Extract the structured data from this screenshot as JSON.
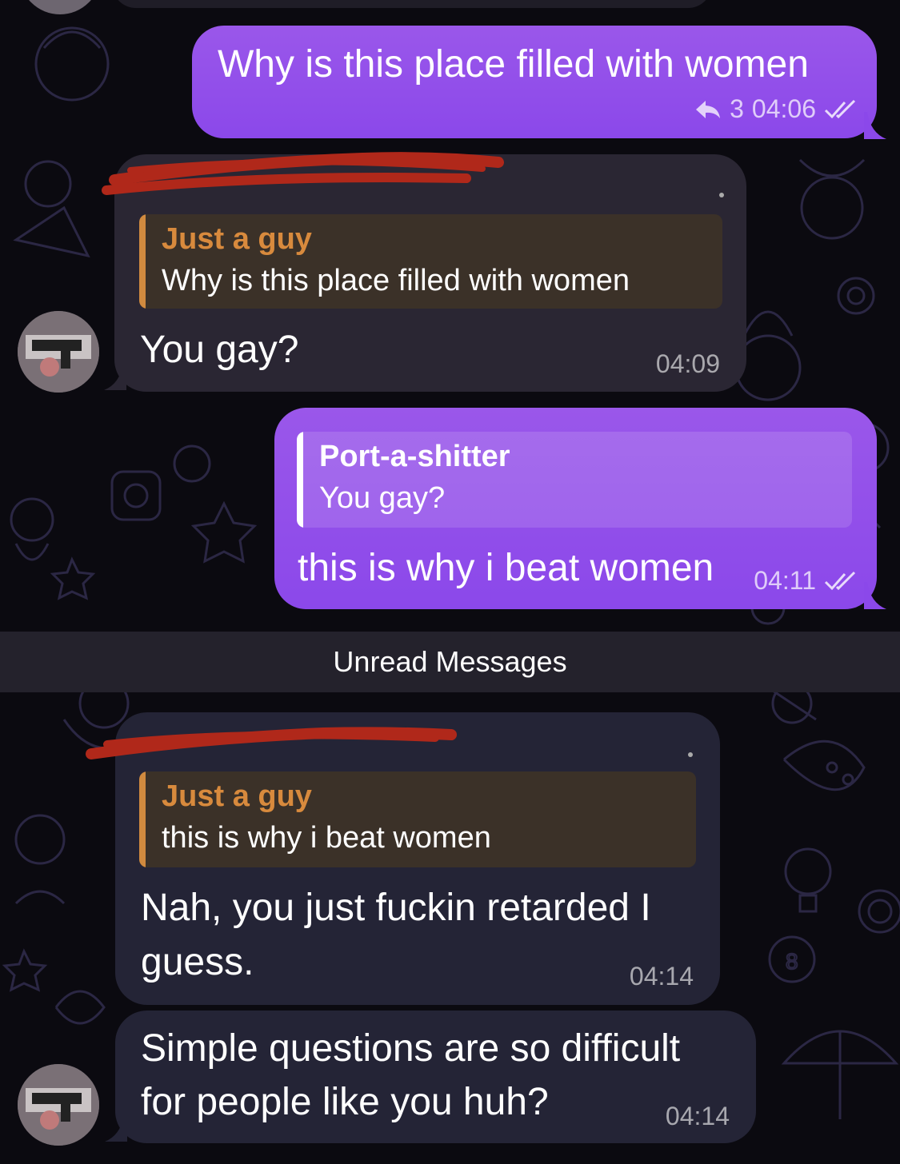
{
  "theme": {
    "accent_out": "#8b48ea",
    "bubble_in": "#2a2633",
    "reply_accent": "#d08a3f",
    "redaction": "#b0281a"
  },
  "messages": [
    {
      "id": "m1",
      "direction": "outgoing",
      "text": "Why is this place filled with women",
      "reply_count": "3",
      "time": "04:06",
      "status": "read",
      "icons": [
        "reply-arrow-icon",
        "double-check-icon"
      ]
    },
    {
      "id": "m2",
      "direction": "incoming",
      "sender_redacted": true,
      "reply_to": {
        "name": "Just a guy",
        "text": "Why is this place filled with women"
      },
      "text": "You gay?",
      "time": "04:09"
    },
    {
      "id": "m3",
      "direction": "outgoing",
      "reply_to": {
        "name": "Port-a-shitter",
        "text": "You gay?"
      },
      "text": "this is why i beat women",
      "time": "04:11",
      "status": "read",
      "icons": [
        "double-check-icon"
      ]
    },
    {
      "id": "m4",
      "direction": "incoming",
      "sender_redacted": true,
      "reply_to": {
        "name": "Just a guy",
        "text": "this is why i beat women"
      },
      "text_line1": "Nah, you just fuckin retarded I",
      "text_line2": "guess.",
      "time": "04:14"
    },
    {
      "id": "m5",
      "direction": "incoming",
      "text_line1": "Simple questions are so difficult",
      "text_line2": "for people like you huh?",
      "time": "04:14"
    }
  ],
  "divider": {
    "label": "Unread Messages"
  }
}
